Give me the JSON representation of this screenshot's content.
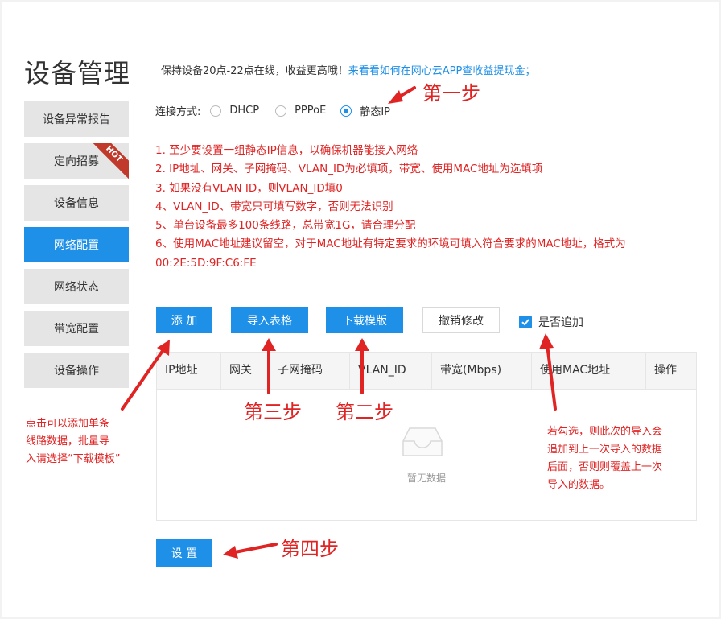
{
  "page": {
    "title": "设备管理"
  },
  "sidebar": {
    "items": [
      {
        "label": "设备异常报告"
      },
      {
        "label": "定向招募",
        "badge": "HOT"
      },
      {
        "label": "设备信息"
      },
      {
        "label": "网络配置",
        "active": true
      },
      {
        "label": "网络状态"
      },
      {
        "label": "带宽配置"
      },
      {
        "label": "设备操作"
      }
    ]
  },
  "notice": {
    "text": "保持设备20点-22点在线，收益更高哦！",
    "link": "来看看如何在网心云APP查收益提现金；"
  },
  "connection": {
    "label": "连接方式:",
    "options": [
      "DHCP",
      "PPPoE",
      "静态IP"
    ],
    "selected": "静态IP"
  },
  "rules": [
    "1. 至少要设置一组静态IP信息，以确保机器能接入网络",
    "2. IP地址、网关、子网掩码、VLAN_ID为必填项，带宽、使用MAC地址为选填项",
    "3. 如果没有VLAN ID，则VLAN_ID填0",
    "4、VLAN_ID、带宽只可填写数字，否则无法识别",
    "5、单台设备最多100条线路，总带宽1G，请合理分配",
    "6、使用MAC地址建议留空，对于MAC地址有特定要求的环境可填入符合要求的MAC地址，格式为",
    "00:2E:5D:9F:C6:FE"
  ],
  "toolbar": {
    "add": "添 加",
    "import": "导入表格",
    "download": "下载模版",
    "revert": "撤销修改",
    "append": "是否追加",
    "append_checked": true
  },
  "table": {
    "columns": [
      "IP地址",
      "网关",
      "子网掩码",
      "VLAN_ID",
      "带宽(Mbps)",
      "使用MAC地址",
      "操作"
    ],
    "rows": [],
    "empty_text": "暂无数据"
  },
  "submit": {
    "label": "设 置"
  },
  "annotations": {
    "step1": "第一步",
    "step2": "第二步",
    "step3": "第三步",
    "step4": "第四步",
    "add_hint": [
      "点击可以添加单条",
      "线路数据，批量导",
      "入请选择“下载模板”"
    ],
    "append_hint": [
      "若勾选，则此次的导入会",
      "追加到上一次导入的数据",
      "后面，否则则覆盖上一次",
      "导入的数据。"
    ]
  },
  "colors": {
    "primary": "#1e90e8",
    "annotation": "#e02424"
  }
}
